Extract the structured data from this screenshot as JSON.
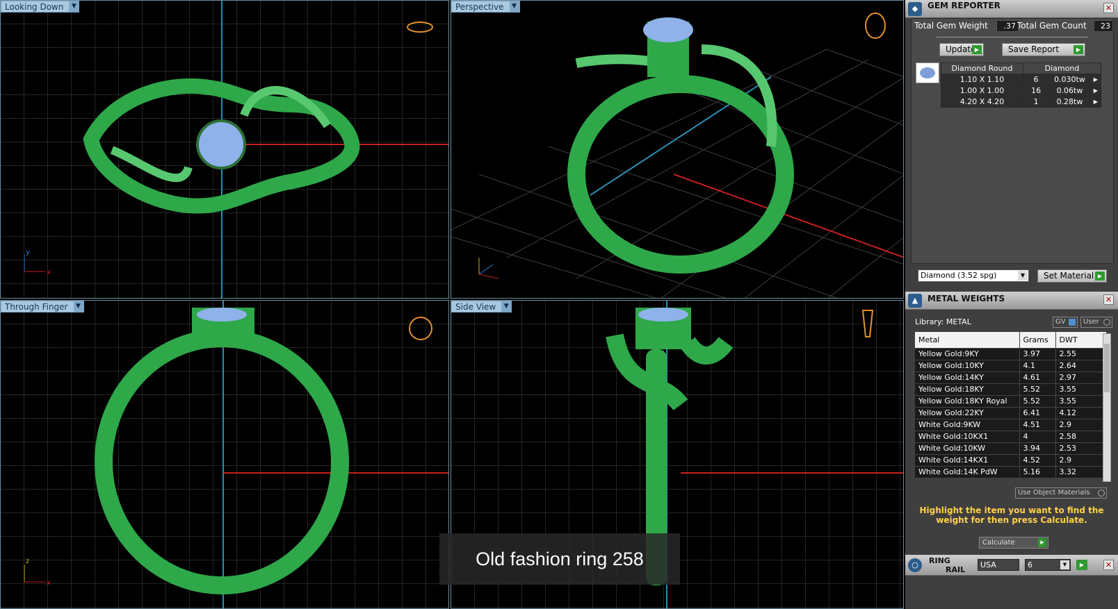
{
  "viewports": [
    {
      "label": "Looking Down"
    },
    {
      "label": "Perspective"
    },
    {
      "label": "Through Finger"
    },
    {
      "label": "Side View"
    }
  ],
  "caption": "Old fashion ring 258",
  "gem_reporter": {
    "title": "GEM REPORTER",
    "total_weight_label": "Total Gem Weight",
    "total_weight_value": ".37",
    "total_count_label": "Total Gem Count",
    "total_count_value": "23",
    "update_label": "Update",
    "save_report_label": "Save Report",
    "header_shape": "Diamond Round",
    "header_material": "Diamond",
    "rows": [
      {
        "size": "1.10 X 1.10",
        "count": "6",
        "weight": "0.030tw"
      },
      {
        "size": "1.00 X 1.00",
        "count": "16",
        "weight": "0.06tw"
      },
      {
        "size": "4.20 X 4.20",
        "count": "1",
        "weight": "0.28tw"
      }
    ],
    "material_select": "Diamond    (3.52 spg)",
    "set_material_label": "Set Material"
  },
  "metal_weights": {
    "title": "METAL WEIGHTS",
    "library_label": "Library: METAL",
    "gv_label": "GV",
    "user_label": "User",
    "columns": [
      "Metal",
      "Grams",
      "DWT"
    ],
    "rows": [
      {
        "metal": "Yellow Gold:9KY",
        "grams": "3.97",
        "dwt": "2.55"
      },
      {
        "metal": "Yellow Gold:10KY",
        "grams": "4.1",
        "dwt": "2.64"
      },
      {
        "metal": "Yellow Gold:14KY",
        "grams": "4.61",
        "dwt": "2.97"
      },
      {
        "metal": "Yellow Gold:18KY",
        "grams": "5.52",
        "dwt": "3.55"
      },
      {
        "metal": "Yellow Gold:18KY Royal",
        "grams": "5.52",
        "dwt": "3.55"
      },
      {
        "metal": "Yellow Gold:22KY",
        "grams": "6.41",
        "dwt": "4.12"
      },
      {
        "metal": "White Gold:9KW",
        "grams": "4.51",
        "dwt": "2.9"
      },
      {
        "metal": "White Gold:10KX1",
        "grams": "4",
        "dwt": "2.58"
      },
      {
        "metal": "White Gold:10KW",
        "grams": "3.94",
        "dwt": "2.53"
      },
      {
        "metal": "White Gold:14KX1",
        "grams": "4.52",
        "dwt": "2.9"
      },
      {
        "metal": "White Gold:14K PdW",
        "grams": "5.16",
        "dwt": "3.32"
      }
    ],
    "use_object_label": "Use Object Materials",
    "hint": "Highlight the item you want to find the weight for then press Calculate.",
    "calculate_label": "Calculate"
  },
  "ring_rail": {
    "title_line1": "RING",
    "title_line2": "RAIL",
    "country": "USA",
    "size": "6"
  },
  "colors": {
    "ring": "#2fa84a",
    "gem": "#8fb2ea",
    "accent": "#a9c9e0"
  }
}
